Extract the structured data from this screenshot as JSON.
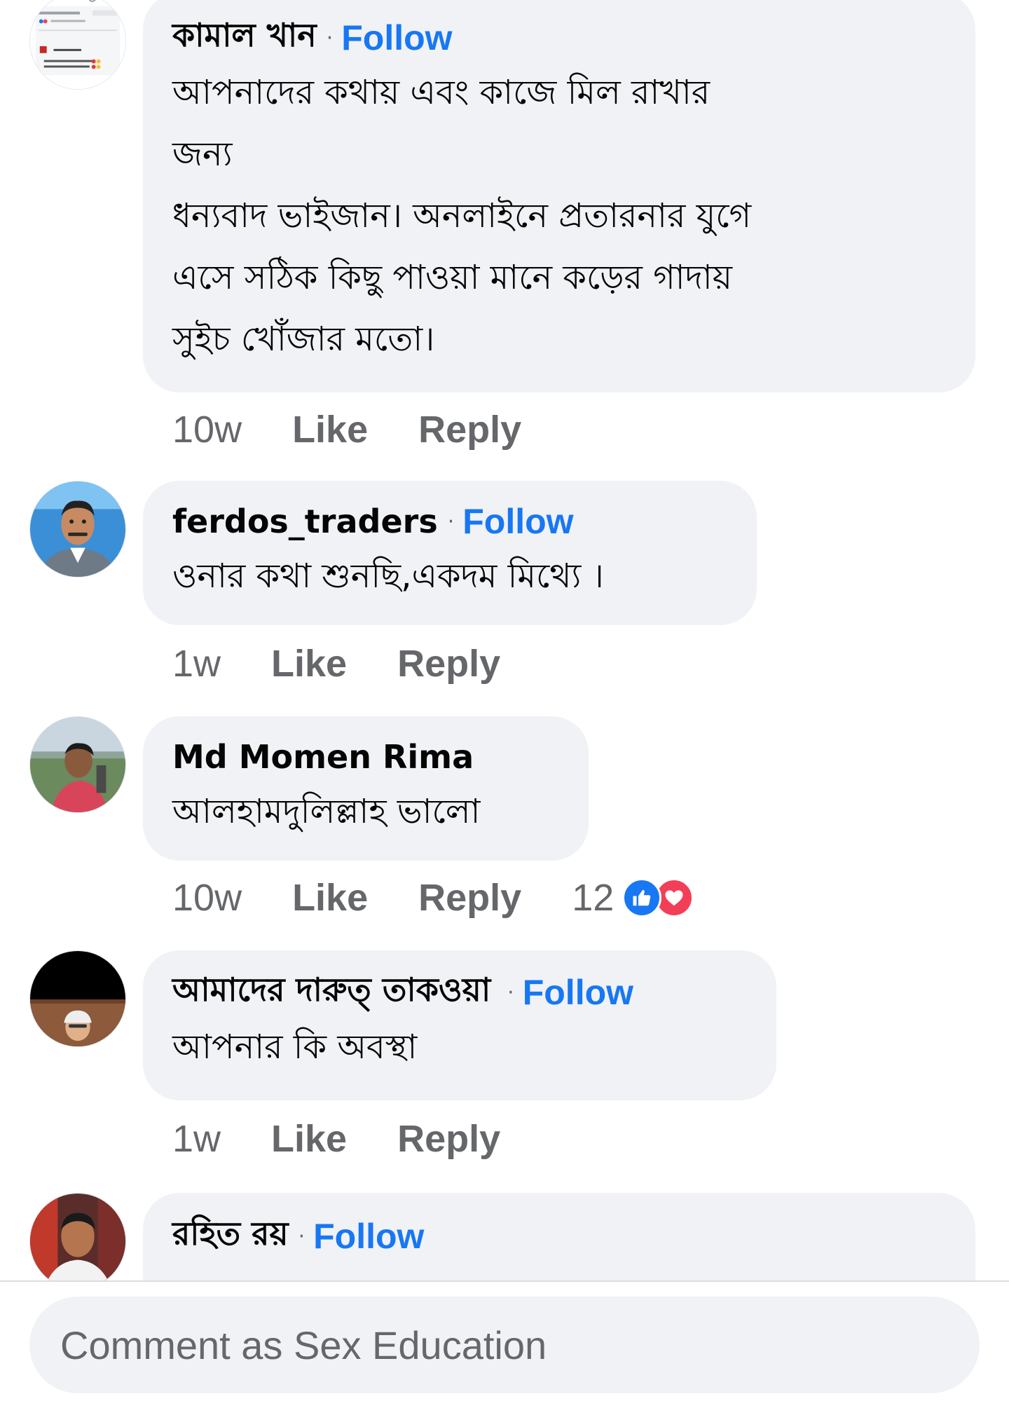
{
  "comments": [
    {
      "author": "কামাল খান",
      "follow_label": "Follow",
      "text_lines": [
        "আপনাদের কথায় এবং কাজে মিল রাখার",
        "জন্য",
        "ধন্যবাদ ভাইজান। অনলাইনে প্রতারনার যুগে",
        "এসে সঠিক কিছু পাওয়া মানে কড়ের গাদায়",
        "সুইচ খোঁজার মতো।"
      ],
      "time": "10w",
      "like_label": "Like",
      "reply_label": "Reply"
    },
    {
      "author": "ferdos_traders",
      "follow_label": "Follow",
      "text_lines": [
        "ওনার কথা শুনছি,একদম মিথ্যে ।"
      ],
      "time": "1w",
      "like_label": "Like",
      "reply_label": "Reply"
    },
    {
      "author": "Md Momen Rima",
      "text_lines": [
        "আলহামদুলিল্লাহ ভালো"
      ],
      "time": "10w",
      "like_label": "Like",
      "reply_label": "Reply",
      "reaction_count": "12",
      "reaction_icons": [
        "like-icon",
        "love-icon"
      ]
    },
    {
      "author": "আমাদের দারুত্ তাকওয়া",
      "follow_label": "Follow",
      "text_lines": [
        "আপনার কি অবস্থা"
      ],
      "time": "1w",
      "like_label": "Like",
      "reply_label": "Reply"
    },
    {
      "author": "রহিত রয়",
      "follow_label": "Follow"
    }
  ],
  "composer": {
    "placeholder": "Comment as Sex Education"
  },
  "colors": {
    "bubble": "#f0f2f5",
    "link": "#1877f2",
    "secondary_text": "#65676b",
    "love": "#f33e58"
  }
}
